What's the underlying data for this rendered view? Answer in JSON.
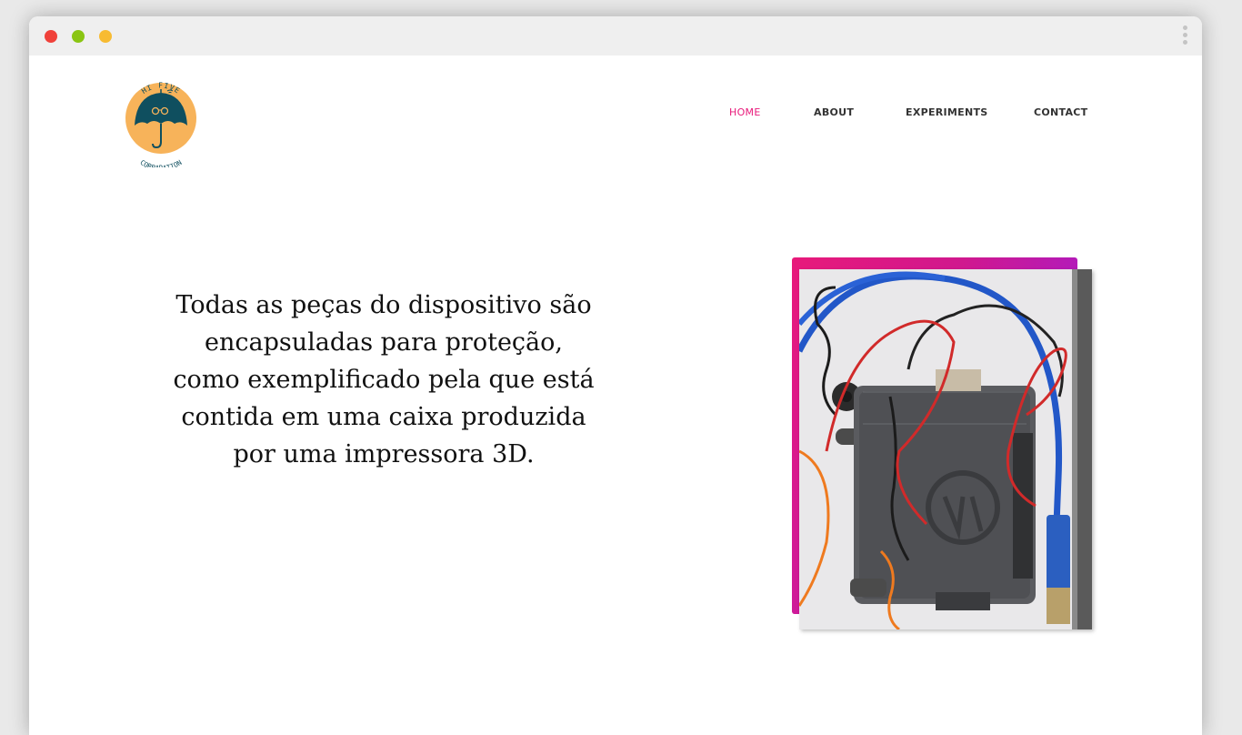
{
  "brand": {
    "logo_top_text": "HI FIVE",
    "logo_bottom_text": "CORPARATION"
  },
  "nav": {
    "items": [
      {
        "label": "HOME",
        "active": true
      },
      {
        "label": "ABOUT",
        "active": false
      },
      {
        "label": "EXPERIMENTS",
        "active": false
      },
      {
        "label": "CONTACT",
        "active": false
      }
    ]
  },
  "hero": {
    "lines": [
      "Todas as peças do dispositivo são",
      "encapsuladas para proteção,",
      "como exemplificado pela que está",
      "contida em uma caixa produzida",
      "por uma impressora 3D."
    ]
  },
  "colors": {
    "accent": "#e8197a",
    "gradient_end": "#b41ab8",
    "logo_circle": "#f7b35a",
    "umbrella": "#0f4f5f",
    "nav_text": "#333333"
  },
  "photo": {
    "subject": "3D-printed enclosure with red, black, orange and blue cables"
  }
}
